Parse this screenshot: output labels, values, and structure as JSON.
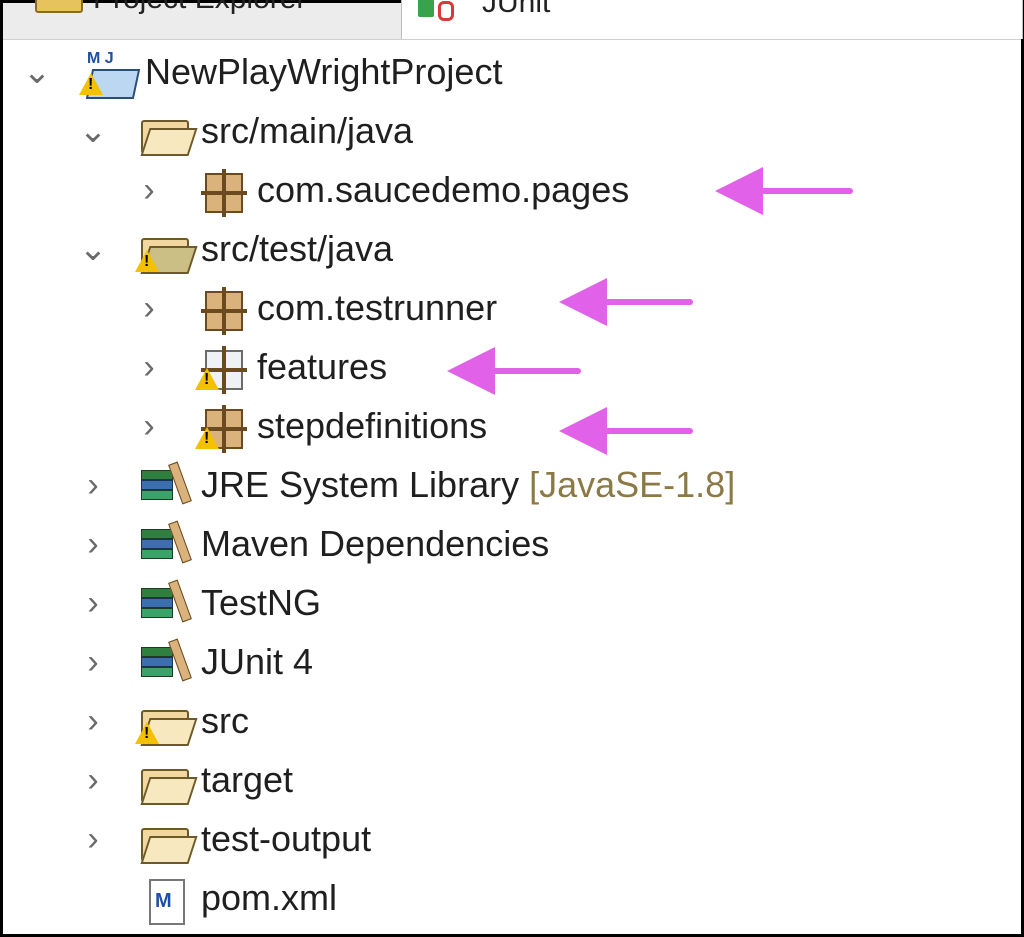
{
  "tabs": {
    "project_explorer": "Project Explorer",
    "junit": "JUnit"
  },
  "tree": {
    "items": [
      {
        "label": "NewPlayWrightProject",
        "icon": "java-maven-project-icon"
      },
      {
        "label": "src/main/java",
        "icon": "source-folder-icon"
      },
      {
        "label": "com.saucedemo.pages",
        "icon": "package-icon"
      },
      {
        "label": "src/test/java",
        "icon": "source-folder-icon"
      },
      {
        "label": "com.testrunner",
        "icon": "package-icon"
      },
      {
        "label": "features",
        "icon": "package-icon"
      },
      {
        "label": "stepdefinitions",
        "icon": "package-icon"
      },
      {
        "label": "JRE System Library",
        "decor": "[JavaSE-1.8]",
        "icon": "library-icon"
      },
      {
        "label": "Maven Dependencies",
        "icon": "library-icon"
      },
      {
        "label": "TestNG",
        "icon": "library-icon"
      },
      {
        "label": "JUnit 4",
        "icon": "library-icon"
      },
      {
        "label": "src",
        "icon": "folder-icon"
      },
      {
        "label": "target",
        "icon": "folder-icon"
      },
      {
        "label": "test-output",
        "icon": "folder-icon"
      },
      {
        "label": "pom.xml",
        "icon": "maven-pom-icon"
      }
    ]
  },
  "colors": {
    "annotation_arrow": "#e261e9",
    "decoration_text": "#8b7a45",
    "warning": "#f5c000"
  }
}
